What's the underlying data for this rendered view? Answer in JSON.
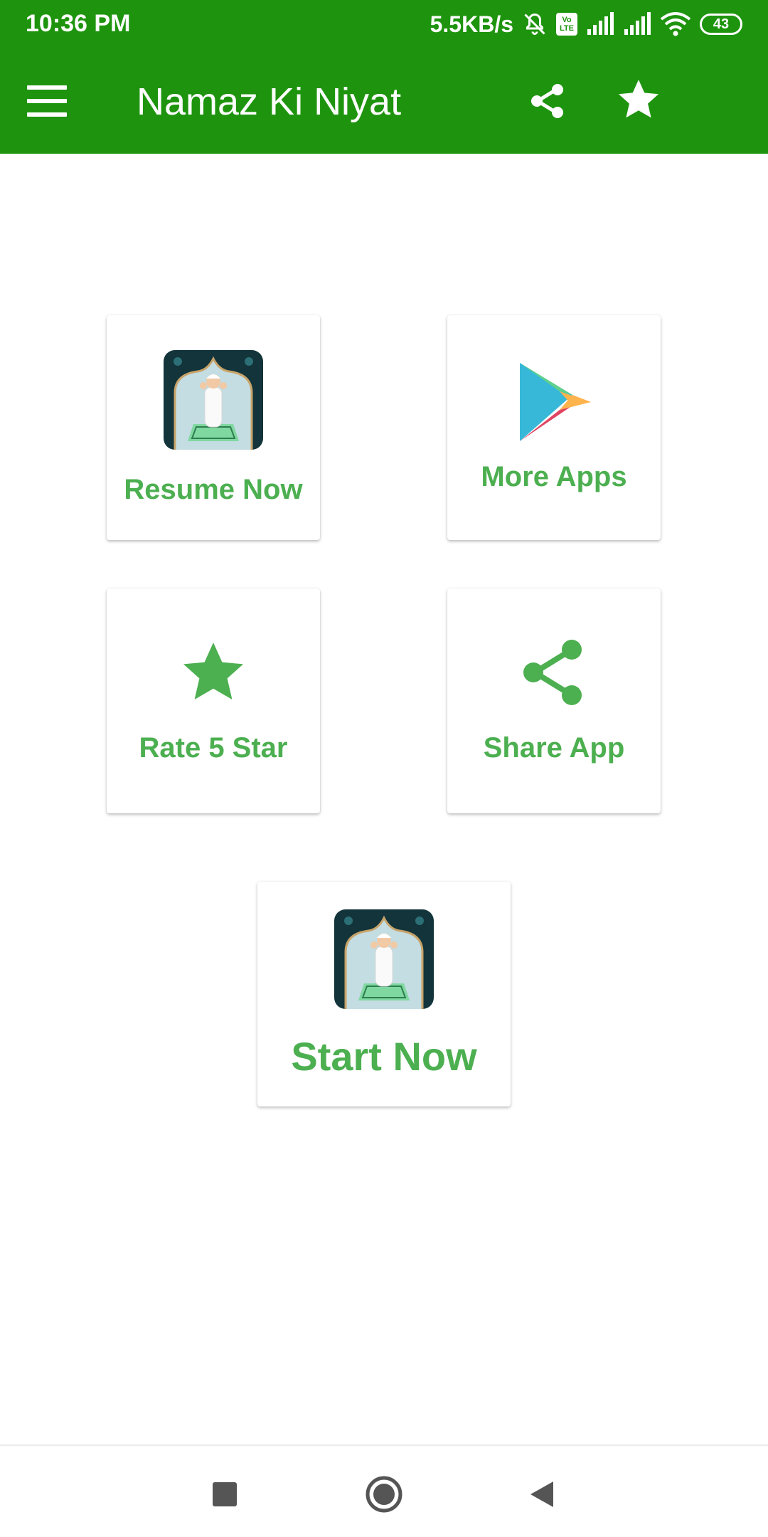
{
  "status_bar": {
    "time": "10:36 PM",
    "net_speed": "5.5KB/s",
    "volte_top": "Vo",
    "volte_bottom": "LTE",
    "battery": "43",
    "icons": [
      "mute-icon",
      "volte-icon",
      "signal-icon",
      "signal-icon",
      "wifi-icon",
      "battery-icon"
    ]
  },
  "app_bar": {
    "title": "Namaz Ki Niyat",
    "actions": [
      "menu-icon",
      "share-icon",
      "star-icon"
    ]
  },
  "cards": {
    "resume": {
      "label": "Resume Now",
      "icon": "prayer-thumbnail"
    },
    "more_apps": {
      "label": "More Apps",
      "icon": "play-store-icon"
    },
    "rate": {
      "label": "Rate 5 Star",
      "icon": "star-icon"
    },
    "share": {
      "label": "Share App",
      "icon": "share-icon"
    },
    "start": {
      "label": "Start Now",
      "icon": "prayer-thumbnail"
    }
  },
  "nav_bar": {
    "buttons": [
      "recents-square-icon",
      "home-circle-icon",
      "back-triangle-icon"
    ]
  },
  "colors": {
    "app_bar": "#1e940e",
    "accent": "#4caf50",
    "background": "#ffffff"
  }
}
